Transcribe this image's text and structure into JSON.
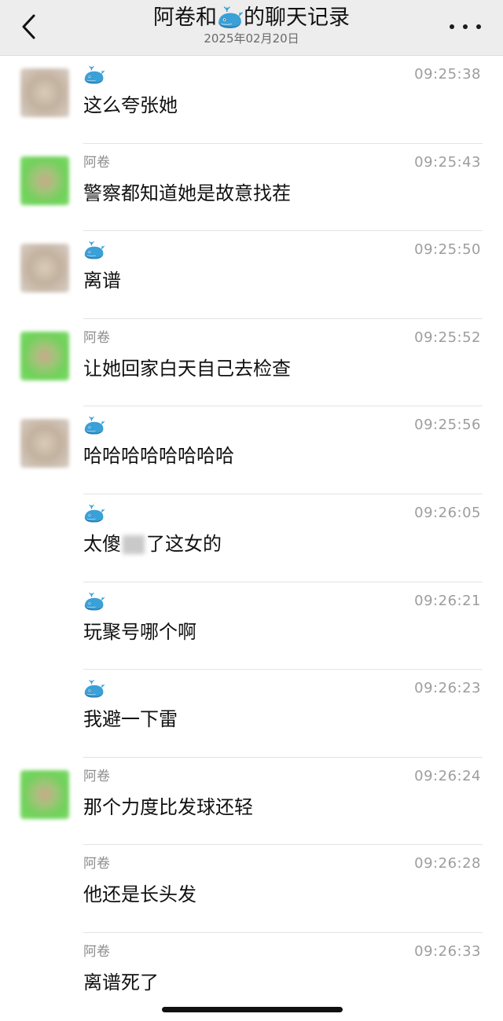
{
  "header": {
    "title_prefix": "阿卷和",
    "title_suffix": "的聊天记录",
    "title_icon": "whale-emoji",
    "date": "2025年02月20日",
    "back_icon": "chevron-left-icon",
    "more_icon": "more-dots-icon"
  },
  "messages": [
    {
      "sender": "",
      "sender_icon": "whale-emoji",
      "avatar": "whale-avatar",
      "time": "09:25:38",
      "text": "这么夸张她"
    },
    {
      "sender": "阿卷",
      "sender_icon": "",
      "avatar": "ajuan-avatar",
      "time": "09:25:43",
      "text": "警察都知道她是故意找茬"
    },
    {
      "sender": "",
      "sender_icon": "whale-emoji",
      "avatar": "whale-avatar",
      "time": "09:25:50",
      "text": "离谱"
    },
    {
      "sender": "阿卷",
      "sender_icon": "",
      "avatar": "ajuan-avatar",
      "time": "09:25:52",
      "text": "让她回家白天自己去检查"
    },
    {
      "sender": "",
      "sender_icon": "whale-emoji",
      "avatar": "whale-avatar",
      "time": "09:25:56",
      "text": "哈哈哈哈哈哈哈哈"
    },
    {
      "sender": "",
      "sender_icon": "whale-emoji",
      "avatar": "",
      "time": "09:26:05",
      "text_before": "太傻",
      "text_after": "了这女的",
      "censored": true
    },
    {
      "sender": "",
      "sender_icon": "whale-emoji",
      "avatar": "",
      "time": "09:26:21",
      "text": "玩聚号哪个啊"
    },
    {
      "sender": "",
      "sender_icon": "whale-emoji",
      "avatar": "",
      "time": "09:26:23",
      "text": "我避一下雷"
    },
    {
      "sender": "阿卷",
      "sender_icon": "",
      "avatar": "ajuan-avatar",
      "time": "09:26:24",
      "text": "那个力度比发球还轻"
    },
    {
      "sender": "阿卷",
      "sender_icon": "",
      "avatar": "",
      "time": "09:26:28",
      "text": "他还是长头发"
    },
    {
      "sender": "阿卷",
      "sender_icon": "",
      "avatar": "",
      "time": "09:26:33",
      "text": "离谱死了"
    }
  ],
  "colors": {
    "header_bg": "#ededed",
    "time_text": "#9d9d9d",
    "sender_text": "#8c8c8c",
    "whale_blue": "#3aa0d8"
  }
}
